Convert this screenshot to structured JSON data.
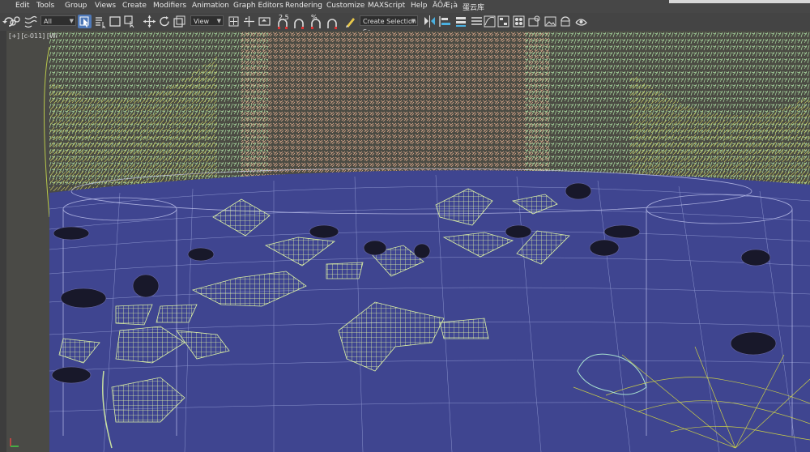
{
  "menu": [
    "Edit",
    "Tools",
    "Group",
    "Views",
    "Create",
    "Modifiers",
    "Animation",
    "Graph Editors",
    "Rendering",
    "Customize",
    "MAXScript",
    "Help",
    "ÄÔÆ¡à",
    "蛋云库"
  ],
  "toolbar": {
    "filter_value": "All",
    "ref_coord_value": "View",
    "snap_label": "2.5",
    "percent_snap_label": "%",
    "selection_set_value": "Create Selection Se"
  },
  "viewport": {
    "label_bracket": "[+]",
    "label_camera": "[c-011]",
    "label_shading": "[Wi"
  },
  "colors": {
    "water": "#3f4590",
    "grid": "#c8d2ff",
    "grass": "#a8e0a0",
    "coral": "#f0b090",
    "yellow_wire": "#d8d84a",
    "lily": "#d8f0a0",
    "fish": "#18182a"
  }
}
